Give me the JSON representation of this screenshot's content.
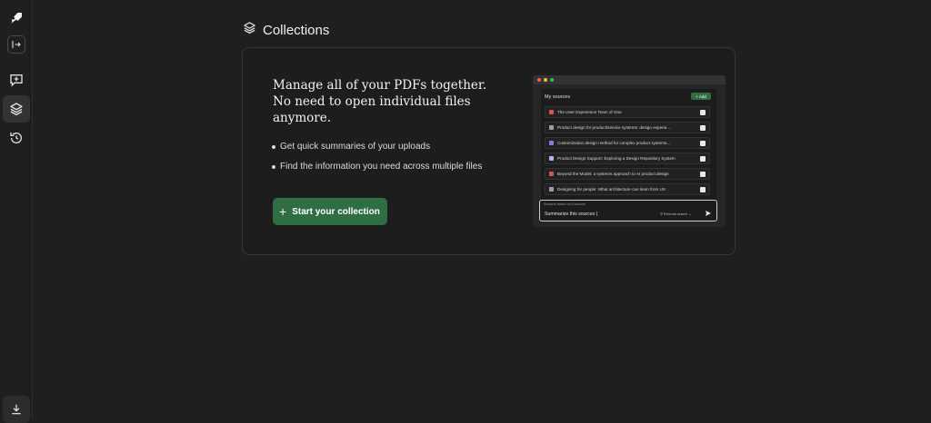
{
  "sidebar": {
    "items": [
      {
        "name": "logo-icon"
      },
      {
        "name": "expand-sidebar-icon"
      },
      {
        "name": "new-chat-icon"
      },
      {
        "name": "collections-icon"
      },
      {
        "name": "history-icon"
      },
      {
        "name": "download-icon"
      }
    ]
  },
  "page": {
    "title": "Collections"
  },
  "hero": {
    "headline": [
      "Manage all of your PDFs together.",
      "No need to open individual files",
      "anymore."
    ],
    "bullets": [
      "Get quick summaries of your uploads",
      "Find the information you need across multiple files"
    ],
    "cta_label": "Start your collection"
  },
  "mock": {
    "sources_title": "My sources",
    "add_label": "Add",
    "sources": [
      {
        "title": "The User Experience Team of One",
        "icon_color": "#d9534f"
      },
      {
        "title": "Product design for product/service systems: design experie...",
        "icon_color": "#9aa0a6"
      },
      {
        "title": "Customization design method for complex product systems...",
        "icon_color": "#7b7fe0"
      },
      {
        "title": "Product Design Support: Exploring a Design Repository System",
        "icon_color": "#b0b4e8"
      },
      {
        "title": "Beyond the Model: a systems approach to AI product design",
        "icon_color": "#d9534f"
      },
      {
        "title": "Designing for people: What architecture can learn from UX",
        "icon_color": "#9aa0a6"
      }
    ],
    "prompt_label": "Answers based on 6 sources",
    "prompt_value": "Summarize this sources |",
    "external_search_label": "External search",
    "window_dots": [
      "#ff5f57",
      "#febc2e",
      "#28c840"
    ]
  },
  "colors": {
    "accent": "#2e6e42",
    "background": "#1f1f1f"
  }
}
